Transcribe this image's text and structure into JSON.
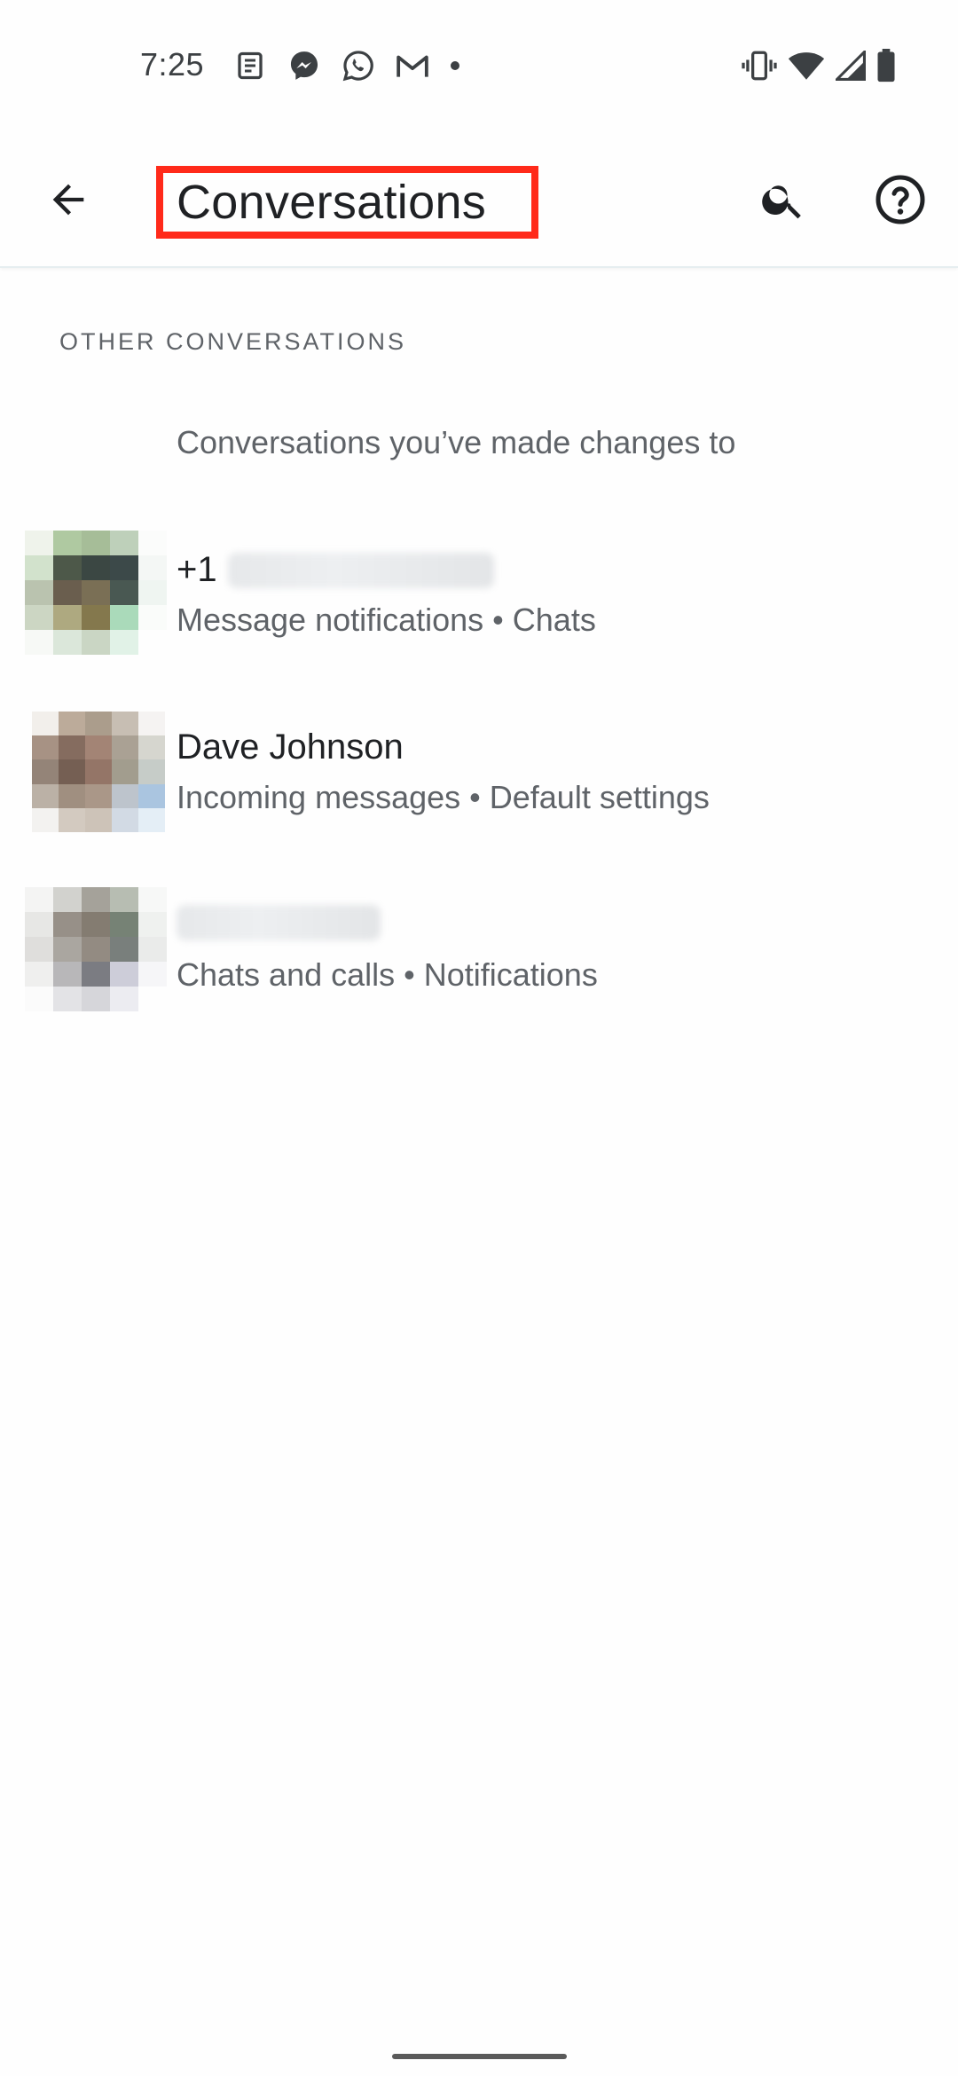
{
  "status_bar": {
    "time": "7:25",
    "notification_icons": [
      "news-icon",
      "messenger-icon",
      "whatsapp-icon",
      "gmail-icon",
      "dot-icon"
    ],
    "system_icons": [
      "vibrate-icon",
      "wifi-icon",
      "signal-icon",
      "battery-icon"
    ]
  },
  "app_bar": {
    "title": "Conversations",
    "highlight_color": "#ff2a1a",
    "actions": [
      "back-arrow-icon",
      "search-icon",
      "help-icon"
    ]
  },
  "section": {
    "header": "OTHER CONVERSATIONS",
    "subtitle": "Conversations you’ve made changes to"
  },
  "conversations": [
    {
      "name_prefix": "+1",
      "name_redacted": true,
      "details": "Message notifications • Chats"
    },
    {
      "name": "Dave Johnson",
      "details": "Incoming messages • Default settings"
    },
    {
      "name_redacted": true,
      "details": "Chats and calls • Notifications"
    }
  ]
}
